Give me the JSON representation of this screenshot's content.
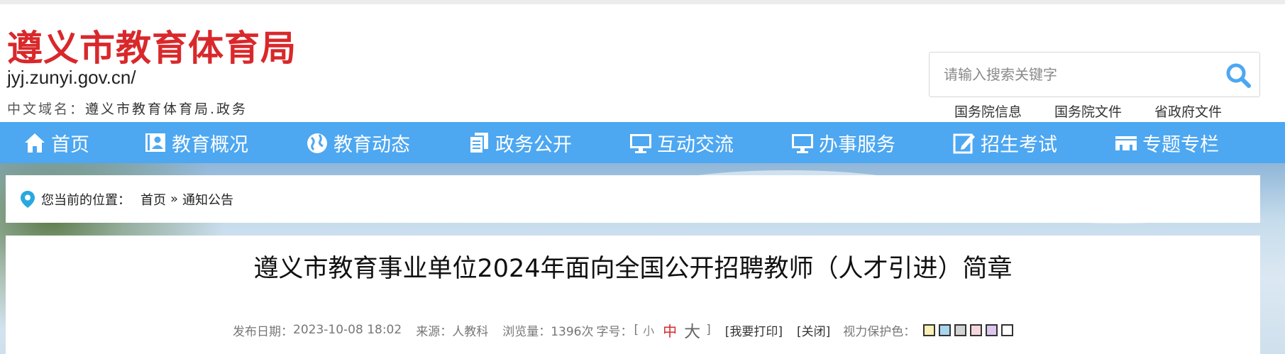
{
  "header": {
    "site_name": "遵义市教育体育局",
    "domain": "jyj.zunyi.gov.cn/",
    "cn_domain_label": "中文域名：",
    "cn_domain_value": "遵义市教育体育局.政务",
    "search_placeholder": "请输入搜索关键字",
    "quick_links": [
      "国务院信息",
      "国务院文件",
      "省政府文件"
    ]
  },
  "nav": {
    "items": [
      {
        "label": "首页",
        "icon": "home-icon"
      },
      {
        "label": "教育概况",
        "icon": "profile-card-icon"
      },
      {
        "label": "教育动态",
        "icon": "globe-icon"
      },
      {
        "label": "政务公开",
        "icon": "documents-icon"
      },
      {
        "label": "互动交流",
        "icon": "monitor-icon"
      },
      {
        "label": "办事服务",
        "icon": "monitor-icon"
      },
      {
        "label": "招生考试",
        "icon": "edit-icon"
      },
      {
        "label": "专题专栏",
        "icon": "folder-icon"
      }
    ]
  },
  "breadcrumb": {
    "prefix": "您当前的位置：",
    "home": "首页",
    "separator": "»",
    "current": "通知公告"
  },
  "article": {
    "title": "遵义市教育事业单位2024年面向全国公开招聘教师（人才引进）简章",
    "publish_label": "发布日期：",
    "publish_date": "2023-10-08 18:02",
    "source_label": "来源：",
    "source": "人教科",
    "views_label": "浏览量：",
    "views": "1396次",
    "fontsize_label": "字号：",
    "bracket_open": "[",
    "size_small": "小",
    "size_medium": "中",
    "size_large": "大",
    "bracket_close": "]",
    "print": "[我要打印]",
    "close": "[关闭]",
    "eye_care_label": "视力保护色："
  },
  "eye_care_colors": [
    "#fbf0b4",
    "#a9d5ef",
    "#d3d3d3",
    "#f6d6dc",
    "#dcc7ef",
    "#ffffff"
  ],
  "colors": {
    "brand_red": "#d9282b",
    "nav_blue": "#4da7f1",
    "search_icon_blue": "#4da7f1"
  }
}
